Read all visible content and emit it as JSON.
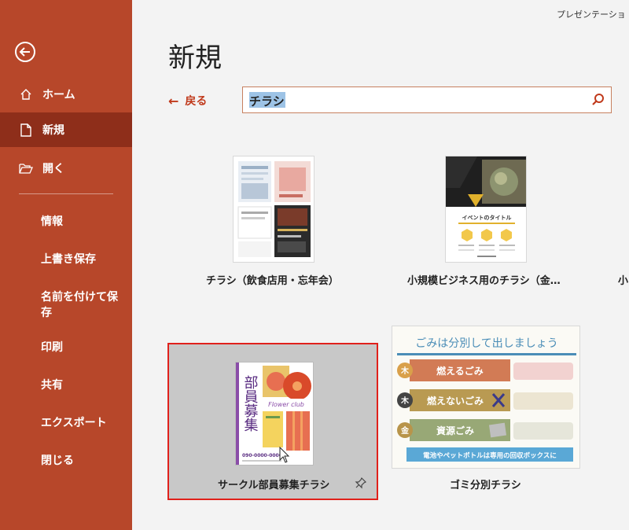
{
  "window": {
    "app_title": "プレゼンテーショ"
  },
  "sidebar": {
    "nav": [
      {
        "label": "ホーム"
      },
      {
        "label": "新規"
      },
      {
        "label": "開く"
      }
    ],
    "sub": [
      {
        "label": "情報"
      },
      {
        "label": "上書き保存"
      },
      {
        "label": "名前を付けて保存"
      },
      {
        "label": "印刷"
      },
      {
        "label": "共有"
      },
      {
        "label": "エクスポート"
      },
      {
        "label": "閉じる"
      }
    ]
  },
  "main": {
    "title": "新規",
    "back_label": "戻る",
    "search": {
      "value": "チラシ"
    },
    "templates": [
      {
        "label": "チラシ（飲食店用・忘年会）"
      },
      {
        "label": "小規模ビジネス用のチラシ（金…"
      },
      {
        "label": "サークル部員募集チラシ"
      },
      {
        "label": "ゴミ分別チラシ"
      }
    ],
    "edge_label": "小"
  },
  "thumb_text": {
    "event_title": "イベントのタイトル",
    "recruit_vertical": "部員募集",
    "flower": "Flower club",
    "gomi_title": "ごみは分別して出しましょう",
    "burnable": "燃えるごみ",
    "nonburnable": "燃えないごみ",
    "resource": "資源ごみ",
    "bottle_note": "電池やペットボトルは専用の回収ボックスに",
    "day1": "木",
    "day2": "木",
    "day3": "金",
    "phone": "090-0000-0000"
  },
  "colors": {
    "sidebar": "#b7472a",
    "sidebar_active": "#8e2e1a",
    "accent": "#c0391b",
    "selection_border": "#e0201b"
  }
}
